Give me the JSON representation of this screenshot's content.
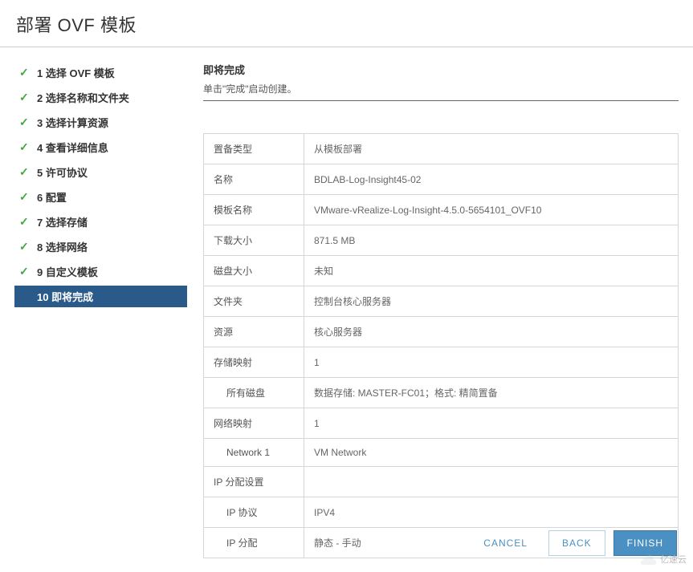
{
  "header": {
    "title": "部署 OVF 模板"
  },
  "sidebar": {
    "steps": [
      {
        "label": "1 选择 OVF 模板",
        "done": true,
        "active": false
      },
      {
        "label": "2 选择名称和文件夹",
        "done": true,
        "active": false
      },
      {
        "label": "3 选择计算资源",
        "done": true,
        "active": false
      },
      {
        "label": "4 查看详细信息",
        "done": true,
        "active": false
      },
      {
        "label": "5 许可协议",
        "done": true,
        "active": false
      },
      {
        "label": "6 配置",
        "done": true,
        "active": false
      },
      {
        "label": "7 选择存储",
        "done": true,
        "active": false
      },
      {
        "label": "8 选择网络",
        "done": true,
        "active": false
      },
      {
        "label": "9 自定义模板",
        "done": true,
        "active": false
      },
      {
        "label": "10 即将完成",
        "done": false,
        "active": true
      }
    ]
  },
  "content": {
    "title": "即将完成",
    "subtitle": "单击\"完成\"启动创建。",
    "rows": [
      {
        "label": "置备类型",
        "value": "从模板部署",
        "indented": false
      },
      {
        "label": "名称",
        "value": "BDLAB-Log-Insight45-02",
        "indented": false
      },
      {
        "label": "模板名称",
        "value": "VMware-vRealize-Log-Insight-4.5.0-5654101_OVF10",
        "indented": false
      },
      {
        "label": "下载大小",
        "value": "871.5 MB",
        "indented": false
      },
      {
        "label": "磁盘大小",
        "value": "未知",
        "indented": false
      },
      {
        "label": "文件夹",
        "value": "控制台核心服务器",
        "indented": false
      },
      {
        "label": "资源",
        "value": "核心服务器",
        "indented": false
      },
      {
        "label": "存储映射",
        "value": "1",
        "indented": false
      },
      {
        "label": "所有磁盘",
        "value": "数据存储: MASTER-FC01；格式: 精简置备",
        "indented": true
      },
      {
        "label": "网络映射",
        "value": "1",
        "indented": false
      },
      {
        "label": "Network 1",
        "value": "VM Network",
        "indented": true
      },
      {
        "label": "IP 分配设置",
        "value": "",
        "indented": false
      },
      {
        "label": "IP 协议",
        "value": "IPV4",
        "indented": true
      },
      {
        "label": "IP 分配",
        "value": "静态 - 手动",
        "indented": true
      }
    ]
  },
  "footer": {
    "cancel": "CANCEL",
    "back": "BACK",
    "finish": "FINISH"
  },
  "watermark": {
    "text": "亿速云"
  }
}
